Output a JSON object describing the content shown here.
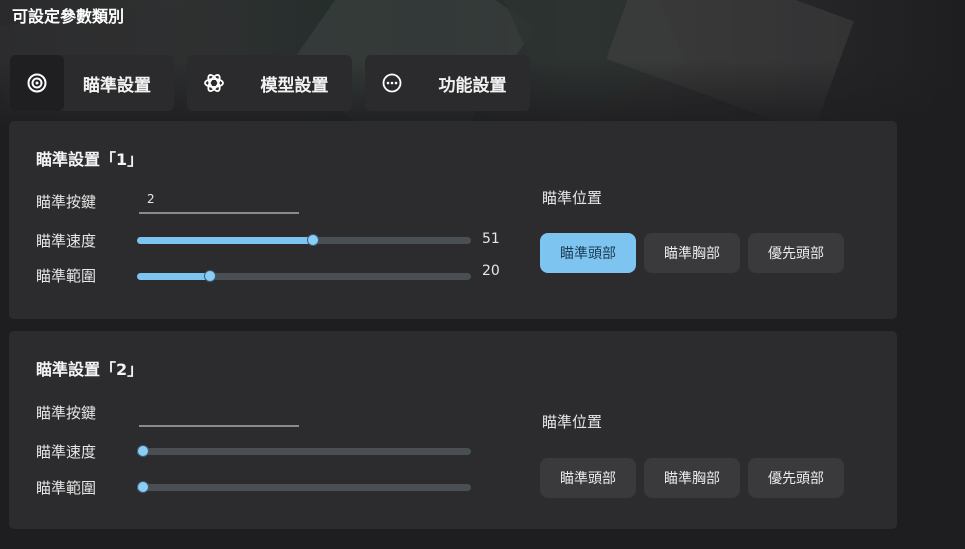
{
  "page_title": "可設定參數類別",
  "tabs": [
    {
      "label": "瞄準設置",
      "icon": "target-icon",
      "active": true
    },
    {
      "label": "模型設置",
      "icon": "atom-icon",
      "active": false
    },
    {
      "label": "功能設置",
      "icon": "more-circle-icon",
      "active": false
    }
  ],
  "panels": [
    {
      "title": "瞄準設置「1」",
      "key_label": "瞄準按鍵",
      "key_value": "2",
      "speed_label": "瞄準速度",
      "speed_value": 51,
      "speed_value_text": "51",
      "range_label": "瞄準範圍",
      "range_value": 20,
      "range_value_text": "20",
      "position_label": "瞄準位置",
      "position_options": [
        "瞄準頭部",
        "瞄準胸部",
        "優先頭部"
      ],
      "selected_position": "瞄準頭部"
    },
    {
      "title": "瞄準設置「2」",
      "key_label": "瞄準按鍵",
      "key_value": "",
      "speed_label": "瞄準速度",
      "speed_value": 0,
      "speed_value_text": "",
      "range_label": "瞄準範圍",
      "range_value": 0,
      "range_value_text": "",
      "position_label": "瞄準位置",
      "position_options": [
        "瞄準頭部",
        "瞄準胸部",
        "優先頭部"
      ],
      "selected_position": ""
    }
  ],
  "colors": {
    "accent": "#7ec4f0",
    "panel": "#2c2c2e",
    "background": "#1e1e20"
  }
}
